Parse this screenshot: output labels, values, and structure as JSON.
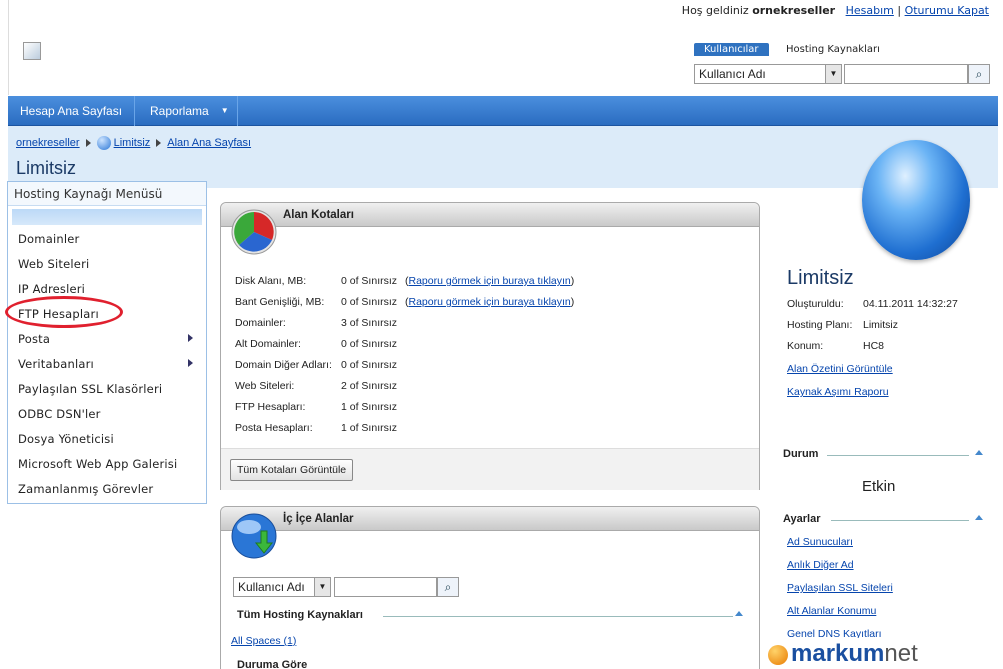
{
  "header": {
    "welcome_prefix": "Hoş geldiniz",
    "username": "ornekreseller",
    "account_link": "Hesabım",
    "logout_link": "Oturumu Kapat",
    "search_tabs": [
      "Kullanıcılar",
      "Hosting Kaynakları"
    ],
    "search_select": "Kullanıcı Adı",
    "search_input": ""
  },
  "nav": {
    "items": [
      "Hesap Ana Sayfası",
      "Raporlama"
    ]
  },
  "breadcrumb": [
    "ornekreseller",
    "Limitsiz",
    "Alan Ana Sayfası"
  ],
  "page_title": "Limitsiz",
  "side_menu": {
    "title": "Hosting Kaynağı Menüsü",
    "items": [
      "Domainler",
      "Web Siteleri",
      "IP Adresleri",
      "FTP Hesapları",
      "Posta",
      "Veritabanları",
      "Paylaşılan SSL Klasörleri",
      "ODBC DSN'ler",
      "Dosya Yöneticisi",
      "Microsoft Web App Galerisi",
      "Zamanlanmış Görevler"
    ]
  },
  "quota_panel": {
    "title": "Alan Kotaları",
    "rows": [
      {
        "label": "Disk Alanı, MB:",
        "value": "0 of Sınırsız",
        "link": "Raporu görmek için buraya tıklayın"
      },
      {
        "label": "Bant Genişliği, MB:",
        "value": "0 of Sınırsız",
        "link": "Raporu görmek için buraya tıklayın"
      },
      {
        "label": "Domainler:",
        "value": "3 of Sınırsız"
      },
      {
        "label": "Alt Domainler:",
        "value": "0 of Sınırsız"
      },
      {
        "label": "Domain Diğer Adları:",
        "value": "0 of Sınırsız"
      },
      {
        "label": "Web Siteleri:",
        "value": "2 of Sınırsız"
      },
      {
        "label": "FTP Hesapları:",
        "value": "1 of Sınırsız"
      },
      {
        "label": "Posta Hesapları:",
        "value": "1 of Sınırsız"
      }
    ],
    "button": "Tüm Kotaları Görüntüle"
  },
  "nested_panel": {
    "title": "İç İçe Alanlar",
    "select": "Kullanıcı Adı",
    "section": "Tüm Hosting Kaynakları",
    "all_spaces": "All Spaces (1)",
    "next_section": "Duruma Göre"
  },
  "right": {
    "name": "Limitsiz",
    "created_label": "Oluşturuldu:",
    "created_value": "04.11.2011 14:32:27",
    "plan_label": "Hosting Planı:",
    "plan_value": "Limitsiz",
    "location_label": "Konum:",
    "location_value": "HC8",
    "link_summary": "Alan Özetini Görüntüle",
    "link_overuse": "Kaynak Aşımı Raporu",
    "status_header": "Durum",
    "status_value": "Etkin",
    "settings_header": "Ayarlar",
    "settings_links": [
      "Ad Sunucuları",
      "Anlık Diğer Ad",
      "Paylaşılan SSL Siteleri",
      "Alt Alanlar Konumu",
      "Genel DNS Kayıtları"
    ]
  },
  "watermark": {
    "brand": "markum",
    "suffix": "net"
  },
  "colors": {
    "accent": "#2f72c0",
    "highlight": "#e0202e"
  }
}
